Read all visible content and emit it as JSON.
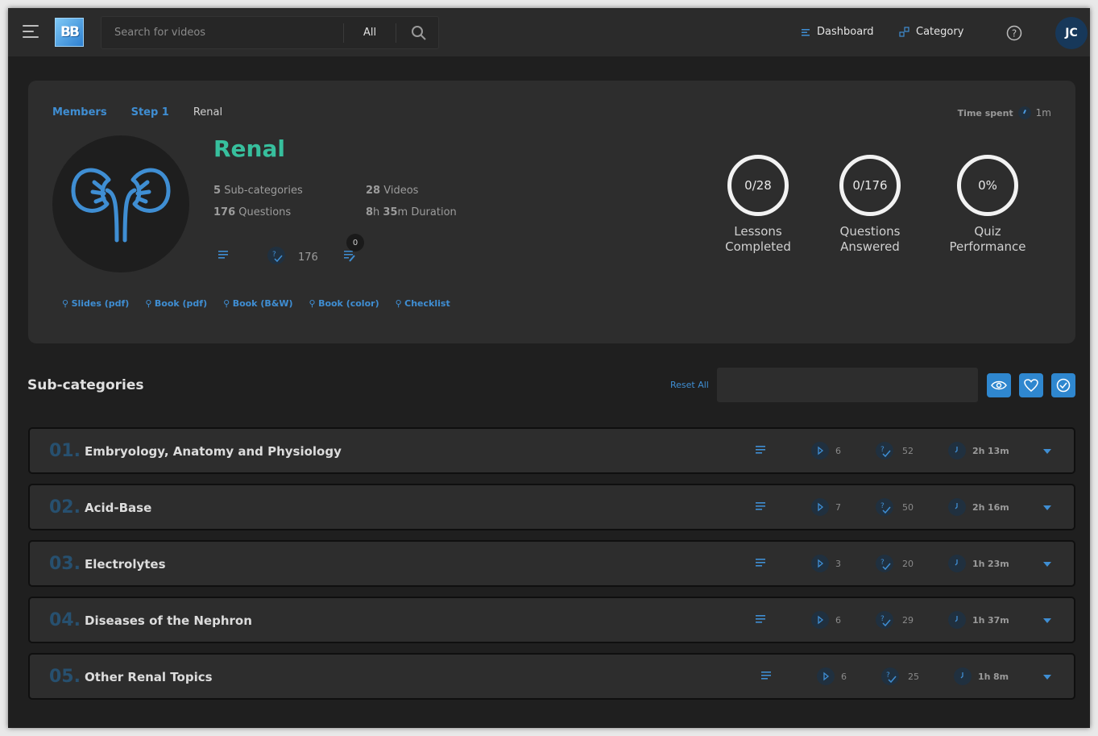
{
  "topbar": {
    "logo_text": "BB",
    "search_placeholder": "Search for videos",
    "search_scope": "All",
    "nav": [
      {
        "label": "Dashboard",
        "icon": "dashboard-icon"
      },
      {
        "label": "Category",
        "icon": "category-icon"
      }
    ],
    "avatar_initials": "JC"
  },
  "breadcrumb": {
    "items": [
      "Members",
      "Step 1"
    ],
    "current": "Renal"
  },
  "time_spent": {
    "label": "Time spent",
    "value": "1m"
  },
  "category": {
    "title": "Renal",
    "icon": "kidney-icon",
    "subcategories_num": "5",
    "subcategories_label": "Sub-categories",
    "videos_num": "28",
    "videos_label": "Videos",
    "questions_num": "176",
    "questions_label": "Questions",
    "duration_h": "8",
    "duration_m": "35",
    "duration_label": "Duration",
    "question_count": "176",
    "notes_badge": "0"
  },
  "resources": [
    "Slides (pdf)",
    "Book (pdf)",
    "Book (B&W)",
    "Book (color)",
    "Checklist"
  ],
  "progress": [
    {
      "value": "0/28",
      "label": "Lessons\nCompleted"
    },
    {
      "value": "0/176",
      "label": "Questions\nAnswered"
    },
    {
      "value": "0%",
      "label": "Quiz\nPerformance"
    }
  ],
  "subcategories_section": {
    "title": "Sub-categories",
    "reset_label": "Reset All",
    "filter_placeholder": ""
  },
  "rows": [
    {
      "num": "01.",
      "name": "Embryology, Anatomy and Physiology",
      "videos": "6",
      "questions": "52",
      "hours": "2h",
      "minutes": "13m"
    },
    {
      "num": "02.",
      "name": "Acid-Base",
      "videos": "7",
      "questions": "50",
      "hours": "2h",
      "minutes": "16m"
    },
    {
      "num": "03.",
      "name": "Electrolytes",
      "videos": "3",
      "questions": "20",
      "hours": "1h",
      "minutes": "23m"
    },
    {
      "num": "04.",
      "name": "Diseases of the Nephron",
      "videos": "6",
      "questions": "29",
      "hours": "1h",
      "minutes": "37m"
    },
    {
      "num": "05.",
      "name": "Other Renal Topics",
      "videos": "6",
      "questions": "25",
      "hours": "1h",
      "minutes": "8m"
    }
  ],
  "colors": {
    "accent": "#3f8ed3",
    "title_green": "#37bf9d",
    "background": "#1f1f1f",
    "card": "#2d2d2d"
  }
}
